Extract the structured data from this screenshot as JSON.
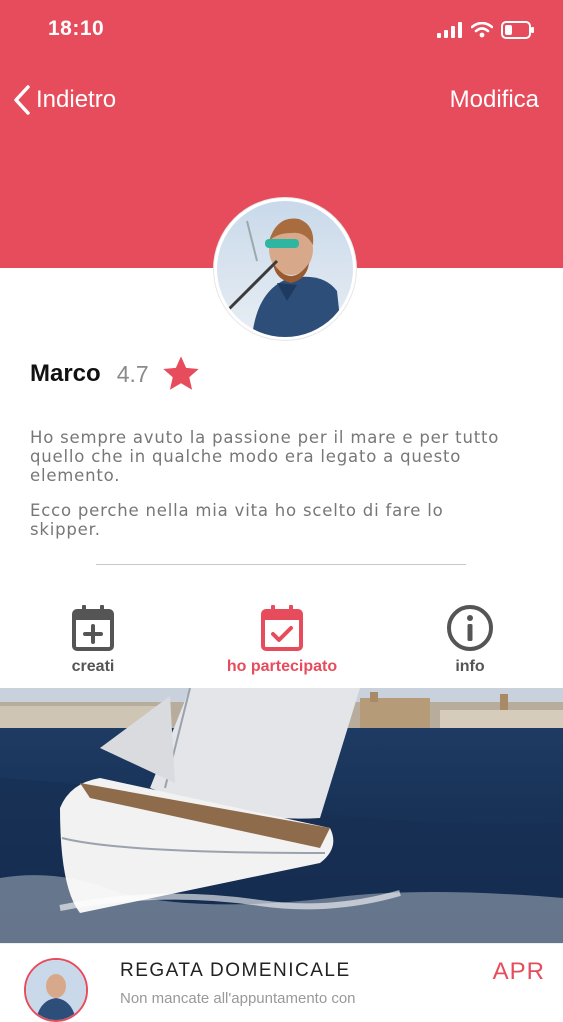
{
  "status_bar": {
    "time": "18:10"
  },
  "nav": {
    "back_label": "Indietro",
    "edit_label": "Modifica"
  },
  "profile": {
    "name": "Marco",
    "rating": "4.7",
    "bio": [
      "Ho sempre avuto la passione per il mare e per tutto quello che in qualche modo era legato a questo elemento.",
      "Ecco perche nella mia vita ho scelto di fare lo skipper."
    ]
  },
  "tabs": [
    {
      "label": "creati",
      "icon": "calendar-plus-icon",
      "active": false
    },
    {
      "label": "ho partecipato",
      "icon": "calendar-check-icon",
      "active": true
    },
    {
      "label": "info",
      "icon": "info-icon",
      "active": false
    }
  ],
  "event": {
    "title": "REGATA DOMENICALE",
    "description": "Non mancate all'appuntamento con",
    "month": "APR"
  },
  "colors": {
    "accent": "#e74c5c",
    "text_dark": "#111111",
    "text_muted": "#777777"
  }
}
